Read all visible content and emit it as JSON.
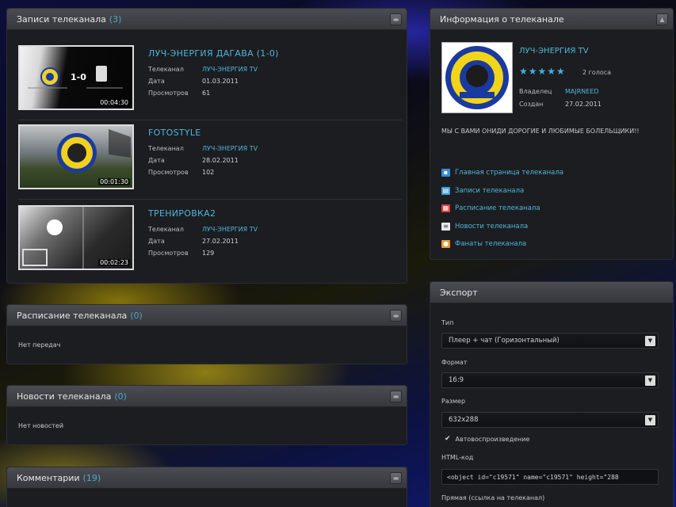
{
  "records_panel": {
    "title": "Записи телеканала",
    "count": "(3)",
    "records": [
      {
        "title": "ЛУЧ-ЭНЕРГИЯ ДАГАВА (1-0)",
        "duration": "00:04:30",
        "channel_label": "Телеканал",
        "channel": "ЛУЧ-ЭНЕРГИЯ TV",
        "date_label": "Дата",
        "date": "01.03.2011",
        "views_label": "Просмотров",
        "views": "61",
        "thumb_score": "1-0"
      },
      {
        "title": "FOTOSTYLE",
        "duration": "00:01:30",
        "channel_label": "Телеканал",
        "channel": "ЛУЧ-ЭНЕРГИЯ TV",
        "date_label": "Дата",
        "date": "28.02.2011",
        "views_label": "Просмотров",
        "views": "102"
      },
      {
        "title": "ТРЕНИРОВКА2",
        "duration": "00:02:23",
        "channel_label": "Телеканал",
        "channel": "ЛУЧ-ЭНЕРГИЯ TV",
        "date_label": "Дата",
        "date": "27.02.2011",
        "views_label": "Просмотров",
        "views": "129"
      }
    ]
  },
  "schedule_panel": {
    "title": "Расписание телеканала",
    "count": "(0)",
    "empty": "Нет передач"
  },
  "news_panel": {
    "title": "Новости телеканала",
    "count": "(0)",
    "empty": "Нет новостей"
  },
  "comments_panel": {
    "title": "Комментарии",
    "count": "(19)"
  },
  "info_panel": {
    "title": "Информация о телеканале",
    "channel_name": "ЛУЧ-ЭНЕРГИЯ TV",
    "stars": "★★★★★",
    "votes": "2 голоса",
    "owner_label": "Владелец",
    "owner": "MAJRNEED",
    "created_label": "Создан",
    "created": "27.02.2011",
    "description": "МЫ С ВАМИ ОНИДИ ДОРОГИЕ И ЛЮБИМЫЕ БОЛЕЛЬЩИКИ!!",
    "links": [
      {
        "label": "Главная страница телеканала",
        "icon": "home-icon",
        "color": "#3a8fd0"
      },
      {
        "label": "Записи телеканала",
        "icon": "film-icon",
        "color": "#3aa0d8"
      },
      {
        "label": "Расписание телеканала",
        "icon": "calendar-icon",
        "color": "#d84040"
      },
      {
        "label": "Новости телеканала",
        "icon": "news-icon",
        "color": "#e8e8e8"
      },
      {
        "label": "Фанаты телеканала",
        "icon": "fans-icon",
        "color": "#e89a30"
      }
    ]
  },
  "export_panel": {
    "title": "Экспорт",
    "type_label": "Тип",
    "type_value": "Плеер + чат (Горизонтальный)",
    "format_label": "Формат",
    "format_value": "16:9",
    "size_label": "Размер",
    "size_value": "632x288",
    "autoplay_label": "Автовоспроизведение",
    "html_label": "HTML-код",
    "html_value": "<object id=\"c19571\" name=\"c19571\" height=\"288",
    "direct_label": "Прямая (ссылка на телеканал)"
  },
  "colors": {
    "accent": "#4fb6d8",
    "panel_bg": "#1c1d21",
    "header_bg": "#404248"
  }
}
